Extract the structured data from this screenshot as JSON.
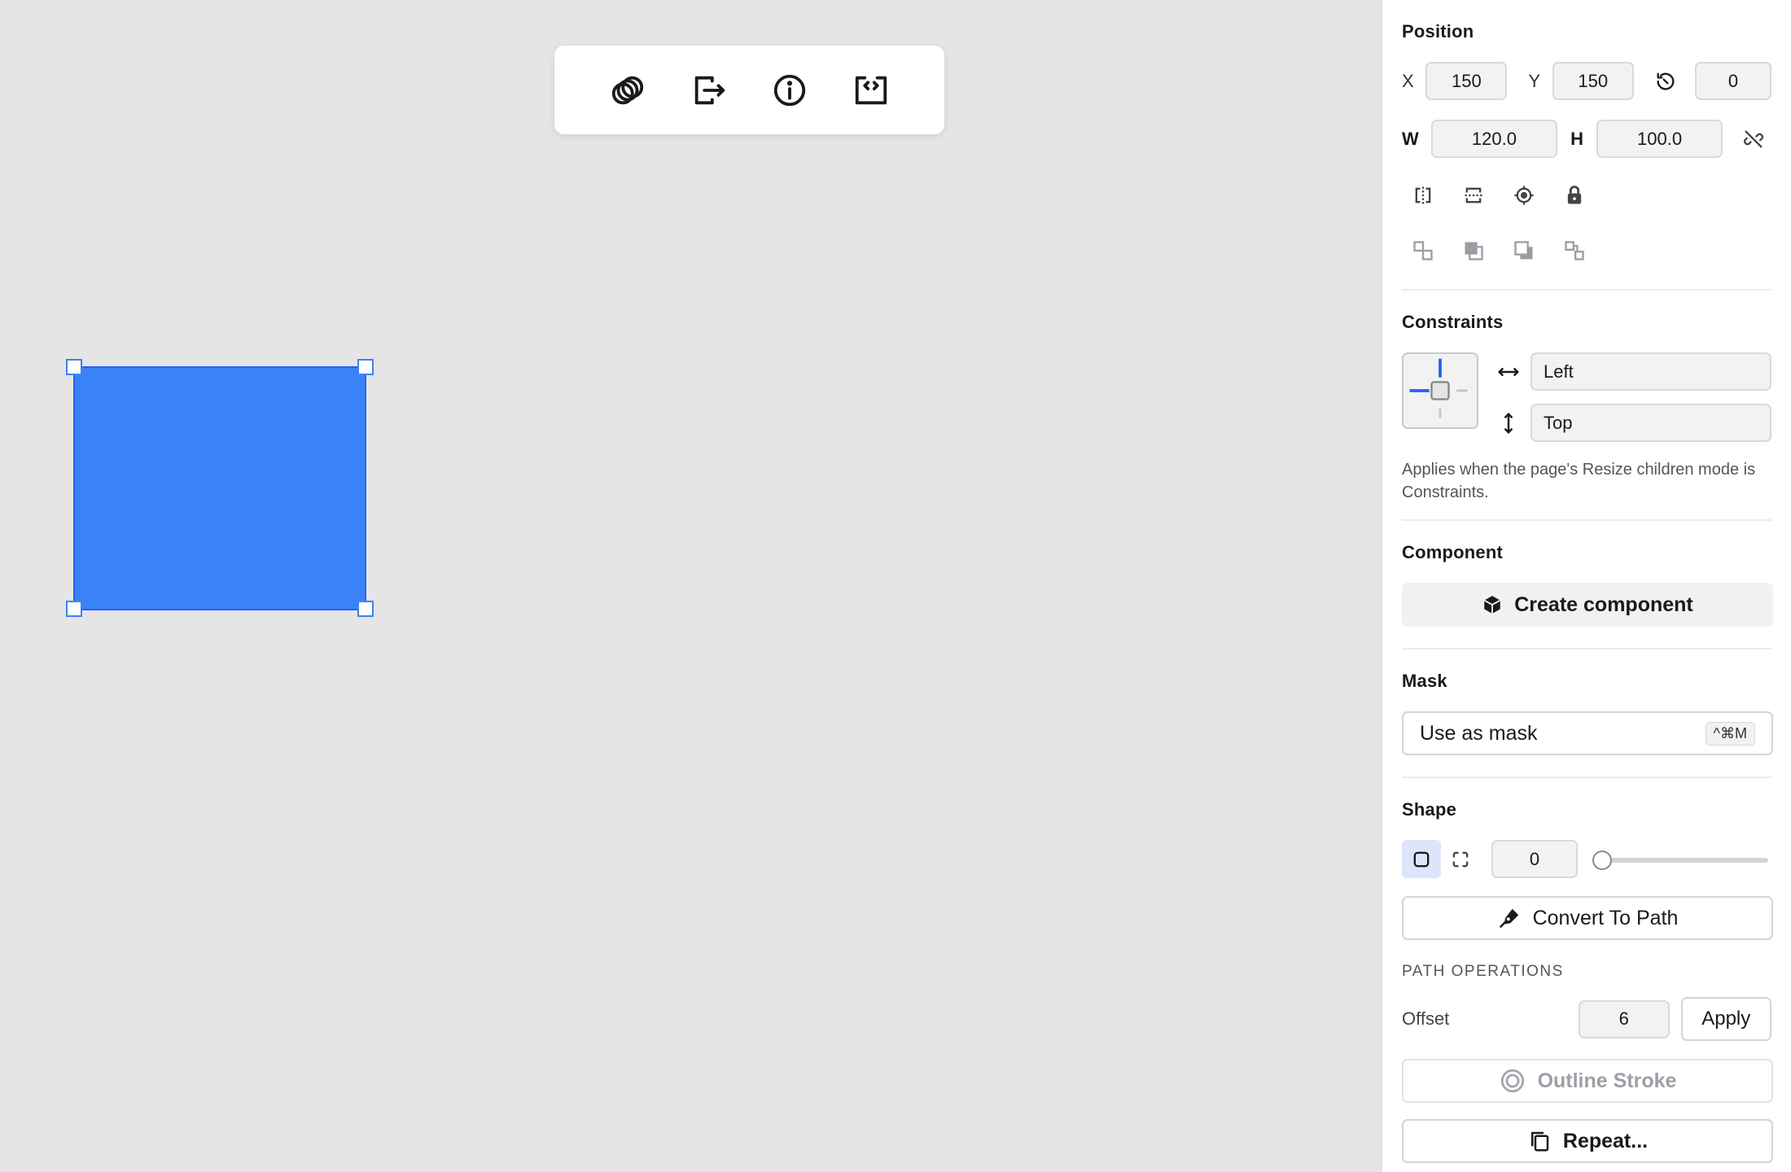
{
  "colors": {
    "accent": "#3b82f6",
    "selected_shape_bg": "#dce6fb"
  },
  "toolbar": {
    "items": [
      {
        "name": "boolean-ops",
        "icon": "overlapping-circles-icon"
      },
      {
        "name": "export",
        "icon": "export-arrow-icon"
      },
      {
        "name": "info",
        "icon": "info-circle-icon"
      },
      {
        "name": "code",
        "icon": "code-icon"
      }
    ]
  },
  "panel": {
    "position": {
      "title": "Position",
      "x_label": "X",
      "x_value": "150",
      "y_label": "Y",
      "y_value": "150",
      "rotation_value": "0",
      "w_label": "W",
      "w_value": "120.0",
      "h_label": "H",
      "h_value": "100.0",
      "icons_row1": [
        "flip-horizontal-icon",
        "flip-vertical-icon",
        "target-icon",
        "lock-icon"
      ],
      "icons_row2": [
        "bring-forward-icon",
        "bring-to-front-icon",
        "send-backward-icon",
        "send-to-back-icon"
      ]
    },
    "constraints": {
      "title": "Constraints",
      "horizontal_value": "Left",
      "vertical_value": "Top",
      "helper": "Applies when the page's Resize children mode is Constraints."
    },
    "component": {
      "title": "Component",
      "create_label": "Create component"
    },
    "mask": {
      "title": "Mask",
      "use_label": "Use as mask",
      "shortcut": "^⌘M"
    },
    "shape": {
      "title": "Shape",
      "radius_value": "0",
      "slider_fraction": 0,
      "convert_label": "Convert To Path",
      "path_ops_title": "PATH OPERATIONS",
      "offset_label": "Offset",
      "offset_value": "6",
      "apply_label": "Apply",
      "outline_label": "Outline Stroke",
      "repeat_label": "Repeat..."
    }
  }
}
